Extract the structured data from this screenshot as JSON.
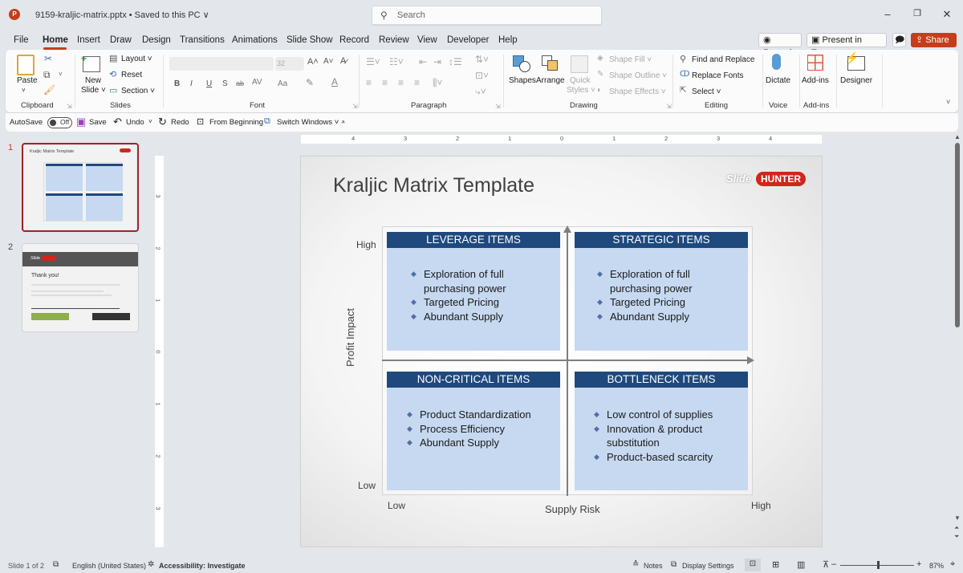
{
  "titlebar": {
    "app_icon": "P",
    "doc_title": "9159-kraljic-matrix.pptx • Saved to this PC ∨",
    "search_placeholder": "Search",
    "window_controls": {
      "minimize": "–",
      "restore": "❐",
      "close": "✕"
    }
  },
  "menu": {
    "tabs": [
      "File",
      "Home",
      "Insert",
      "Draw",
      "Design",
      "Transitions",
      "Animations",
      "Slide Show",
      "Record",
      "Review",
      "View",
      "Developer",
      "Help"
    ],
    "active": "Home",
    "record_btn": "◉ Record",
    "teams_btn": "Present in Teams",
    "comment_icon": "🗩",
    "share_btn": "Share ˅"
  },
  "ribbon": {
    "clipboard": {
      "paste": "Paste",
      "label": "Clipboard"
    },
    "slides": {
      "new_slide": "New",
      "new_slide2": "Slide ˅",
      "layout": "Layout ˅",
      "reset": "Reset",
      "section": "Section ˅",
      "label": "Slides"
    },
    "font": {
      "font_size": "32",
      "bold": "B",
      "italic": "I",
      "underline": "U",
      "shadow": "S",
      "strike": "ab",
      "spacing": "AV",
      "case": "Aa",
      "label": "Font"
    },
    "paragraph": {
      "label": "Paragraph"
    },
    "drawing": {
      "shapes": "Shapes",
      "arrange": "Arrange",
      "quick_styles": "Quick",
      "quick_styles2": "Styles ˅",
      "shape_fill": "Shape Fill ˅",
      "shape_outline": "Shape Outline ˅",
      "shape_effects": "Shape Effects ˅",
      "label": "Drawing"
    },
    "editing": {
      "find_replace": "Find and Replace",
      "replace_fonts": "Replace Fonts",
      "select": "Select ˅",
      "label": "Editing"
    },
    "voice": {
      "dictate": "Dictate",
      "label": "Voice"
    },
    "addins": {
      "addins": "Add-ins",
      "label": "Add-ins"
    },
    "designer": {
      "designer": "Designer"
    }
  },
  "qat": {
    "autosave": "AutoSave",
    "autosave_state": "Off",
    "save": "Save",
    "undo": "Undo",
    "redo": "Redo",
    "from_beginning": "From Beginning",
    "switch_windows": "Switch Windows ˅"
  },
  "thumbnails": [
    {
      "number": "1",
      "title": "Kraljic Matrix Template",
      "selected": true
    },
    {
      "number": "2",
      "title": "Thank you!",
      "selected": false
    }
  ],
  "ruler": {
    "horizontal": [
      "4",
      "3",
      "2",
      "1",
      "0",
      "1",
      "2",
      "3",
      "4"
    ],
    "vertical": [
      "3",
      "2",
      "1",
      "0",
      "1",
      "2",
      "3"
    ]
  },
  "slide": {
    "title": "Kraljic Matrix Template",
    "logo_slide": "Slide",
    "logo_hunter": "HUNTER",
    "y_axis_label": "Profit Impact",
    "x_axis_label": "Supply Risk",
    "y_high": "High",
    "y_low": "Low",
    "x_low": "Low",
    "x_high": "High",
    "quadrants": [
      {
        "title": "LEVERAGE ITEMS",
        "bullets": [
          "Exploration of full purchasing power",
          "Targeted Pricing",
          "Abundant Supply"
        ]
      },
      {
        "title": "STRATEGIC ITEMS",
        "bullets": [
          "Exploration of full purchasing power",
          "Targeted Pricing",
          "Abundant Supply"
        ]
      },
      {
        "title": "NON-CRITICAL ITEMS",
        "bullets": [
          "Product Standardization",
          "Process Efficiency",
          "Abundant Supply"
        ]
      },
      {
        "title": "BOTTLENECK ITEMS",
        "bullets": [
          "Low control of supplies",
          "Innovation & product substitution",
          "Product-based scarcity"
        ]
      }
    ]
  },
  "statusbar": {
    "slide_count": "Slide 1 of 2",
    "language": "English (United States)",
    "accessibility": "Accessibility: Investigate",
    "notes": "Notes",
    "display_settings": "Display Settings",
    "zoom_minus": "–",
    "zoom_plus": "+",
    "zoom_level": "87%"
  },
  "colors": {
    "accent": "#c43e1c",
    "quad_header": "#1f497d",
    "quad_body": "#c6d9f1",
    "thumb_selected": "#a1232b"
  }
}
